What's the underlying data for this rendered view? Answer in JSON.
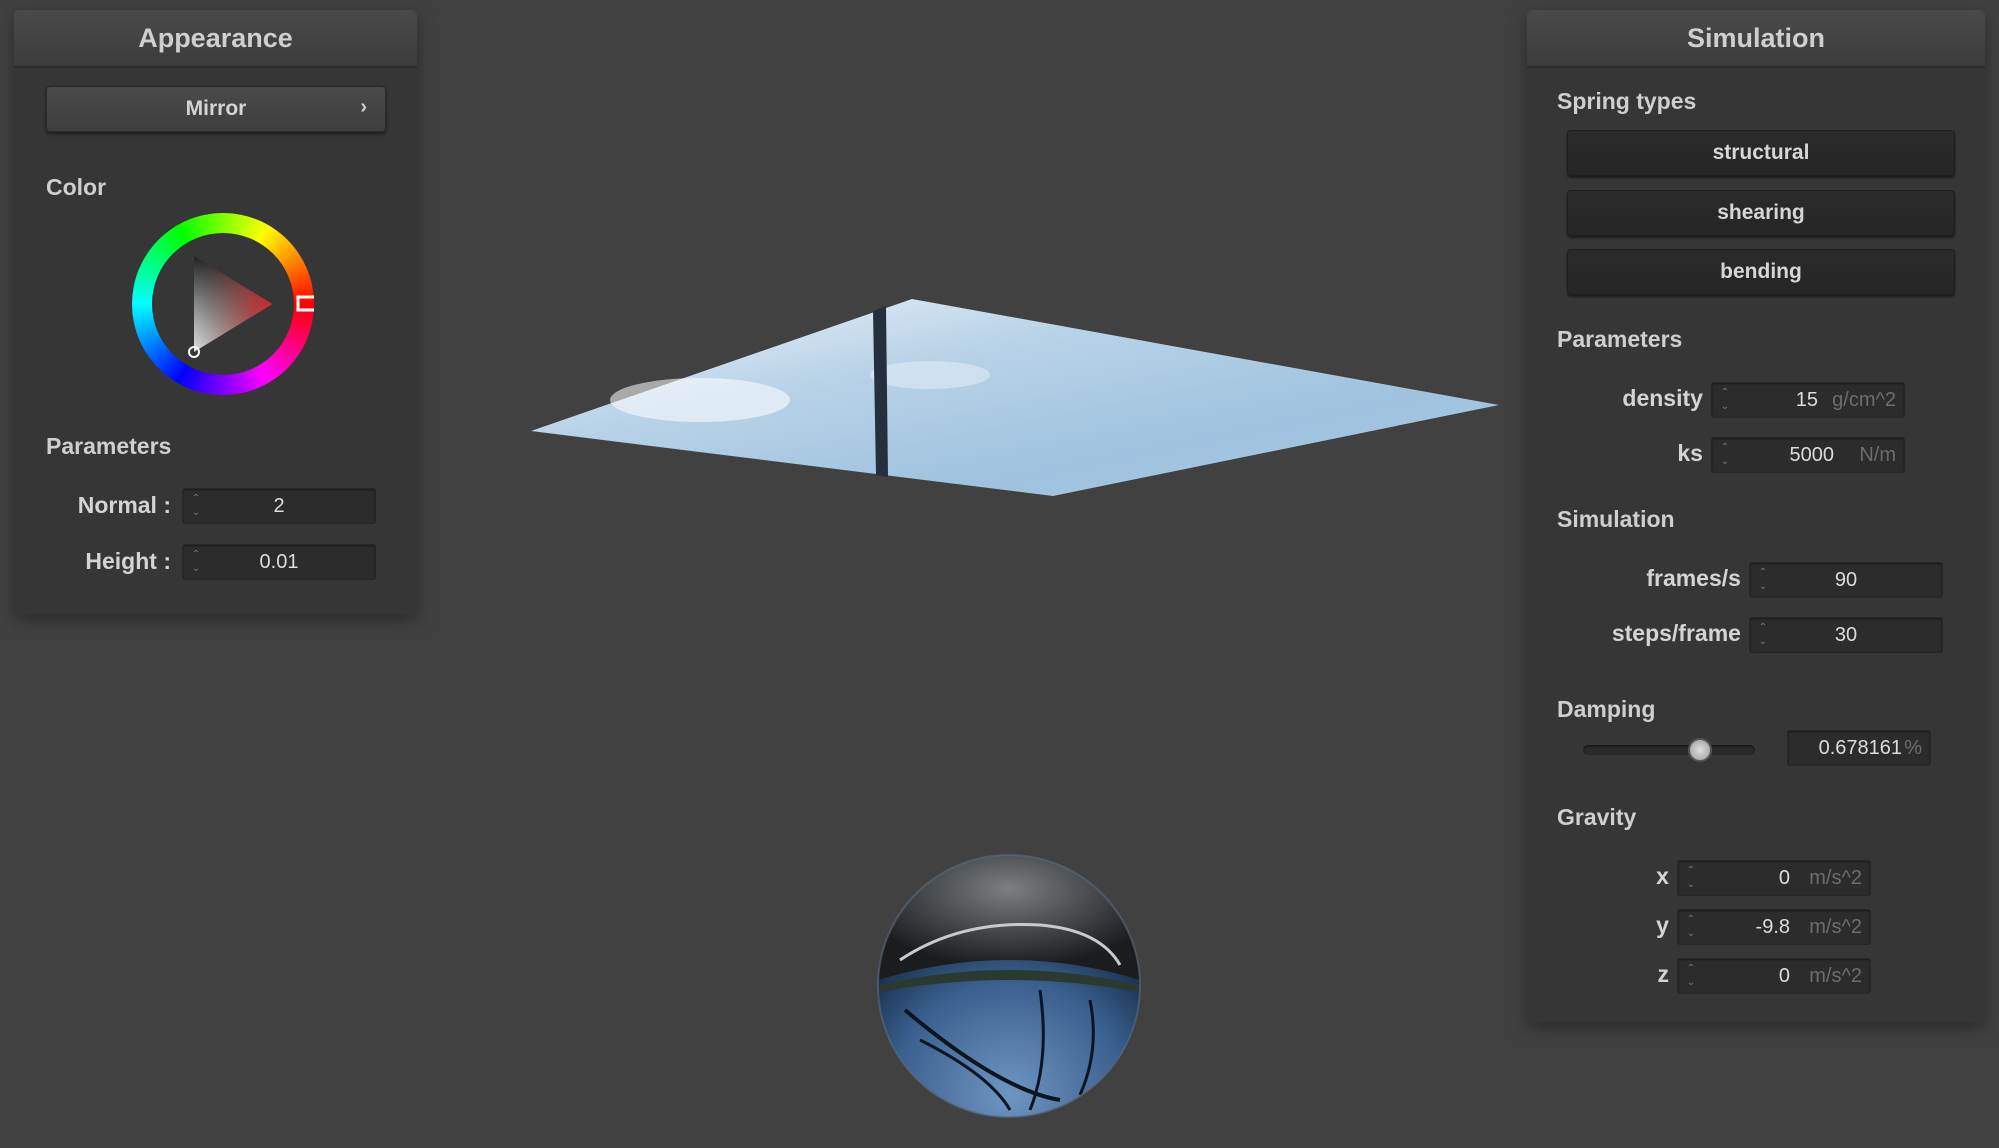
{
  "appearance": {
    "title": "Appearance",
    "material_select": "Mirror",
    "color_label": "Color",
    "parameters_label": "Parameters",
    "normal": {
      "label": "Normal :",
      "value": "2"
    },
    "height": {
      "label": "Height :",
      "value": "0.01"
    }
  },
  "simulation_panel": {
    "title": "Simulation",
    "spring_types_label": "Spring types",
    "spring_types": [
      "structural",
      "shearing",
      "bending"
    ],
    "parameters_label": "Parameters",
    "density": {
      "label": "density :",
      "value": "15",
      "unit": "g/cm^2"
    },
    "ks": {
      "label": "ks :",
      "value": "5000",
      "unit": "N/m"
    },
    "simulation_label": "Simulation",
    "frames": {
      "label": "frames/s :",
      "value": "90"
    },
    "steps": {
      "label": "steps/frame :",
      "value": "30"
    },
    "damping_label": "Damping",
    "damping": {
      "value": "0.678161",
      "unit": "%",
      "slider_fraction": 0.68
    },
    "gravity_label": "Gravity",
    "gravity_x": {
      "label": "x :",
      "value": "0",
      "unit": "m/s^2"
    },
    "gravity_y": {
      "label": "y :",
      "value": "-9.8",
      "unit": "m/s^2"
    },
    "gravity_z": {
      "label": "z :",
      "value": "0",
      "unit": "m/s^2"
    }
  },
  "colors": {
    "background": "#414141",
    "panel": "#363636",
    "selected_color": "#e02020"
  },
  "icons": {
    "select_chevron": "chevron-right-icon",
    "spinner": "spinner-arrows-icon"
  }
}
